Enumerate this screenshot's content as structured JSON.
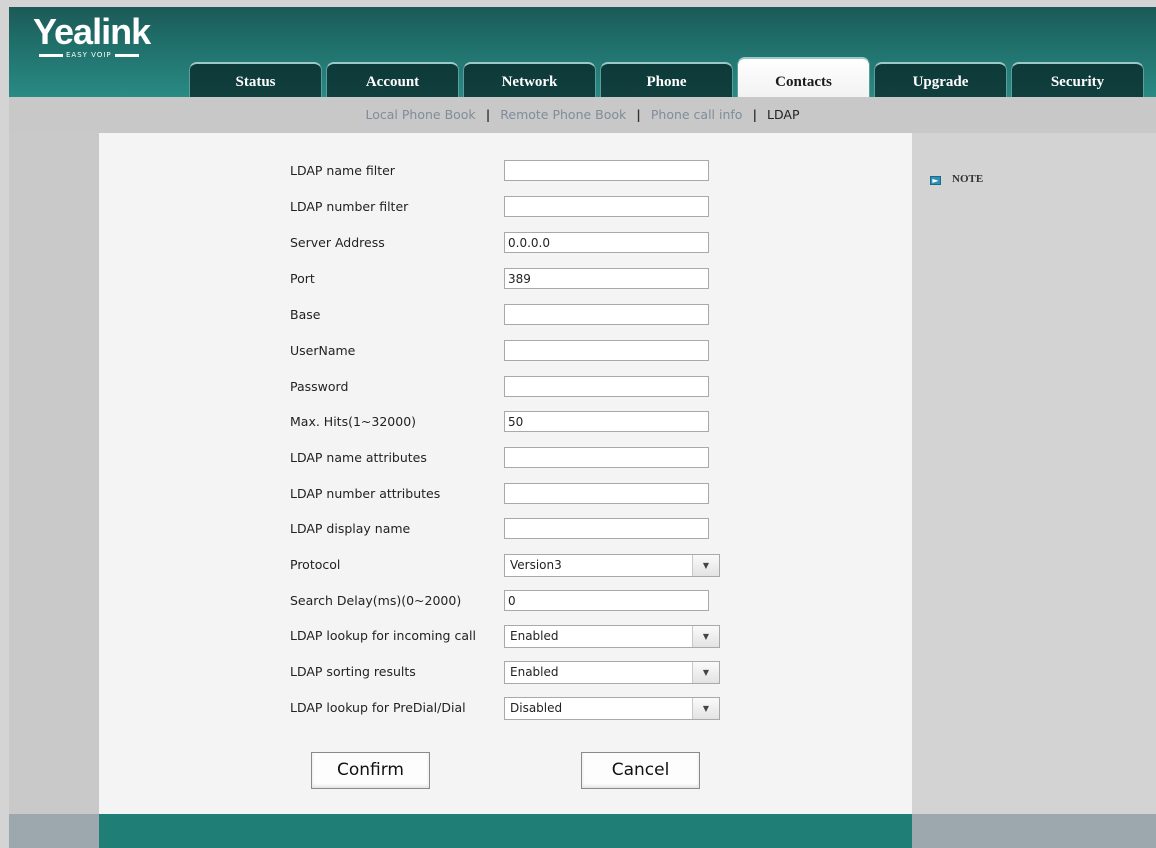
{
  "brand": {
    "name": "Yealink",
    "tagline": "EASY VOIP"
  },
  "tabs": [
    {
      "label": "Status",
      "active": false
    },
    {
      "label": "Account",
      "active": false
    },
    {
      "label": "Network",
      "active": false
    },
    {
      "label": "Phone",
      "active": false
    },
    {
      "label": "Contacts",
      "active": true
    },
    {
      "label": "Upgrade",
      "active": false
    },
    {
      "label": "Security",
      "active": false
    }
  ],
  "subnav": [
    {
      "label": "Local Phone Book",
      "active": false
    },
    {
      "label": "Remote Phone Book",
      "active": false
    },
    {
      "label": "Phone call info",
      "active": false
    },
    {
      "label": "LDAP",
      "active": true
    }
  ],
  "form": {
    "fields": [
      {
        "label": "LDAP name filter",
        "value": ""
      },
      {
        "label": "LDAP number filter",
        "value": ""
      },
      {
        "label": "Server Address",
        "value": "0.0.0.0"
      },
      {
        "label": "Port",
        "value": "389"
      },
      {
        "label": "Base",
        "value": ""
      },
      {
        "label": "UserName",
        "value": ""
      },
      {
        "label": "Password",
        "value": ""
      },
      {
        "label": "Max. Hits(1~32000)",
        "value": "50"
      },
      {
        "label": "LDAP name attributes",
        "value": ""
      },
      {
        "label": "LDAP number attributes",
        "value": ""
      },
      {
        "label": "LDAP display name",
        "value": ""
      },
      {
        "label": "Protocol",
        "value": "Version3",
        "type": "select"
      },
      {
        "label": "Search Delay(ms)(0~2000)",
        "value": "0"
      },
      {
        "label": "LDAP lookup for incoming call",
        "value": "Enabled",
        "type": "select"
      },
      {
        "label": "LDAP sorting results",
        "value": "Enabled",
        "type": "select"
      },
      {
        "label": "LDAP lookup for PreDial/Dial",
        "value": "Disabled",
        "type": "select"
      }
    ],
    "confirm_label": "Confirm",
    "cancel_label": "Cancel"
  },
  "note": {
    "label": "NOTE"
  },
  "colors": {
    "header": "#1e6a66",
    "tab_dark": "#0d3a38",
    "footer": "#1f7e76"
  }
}
